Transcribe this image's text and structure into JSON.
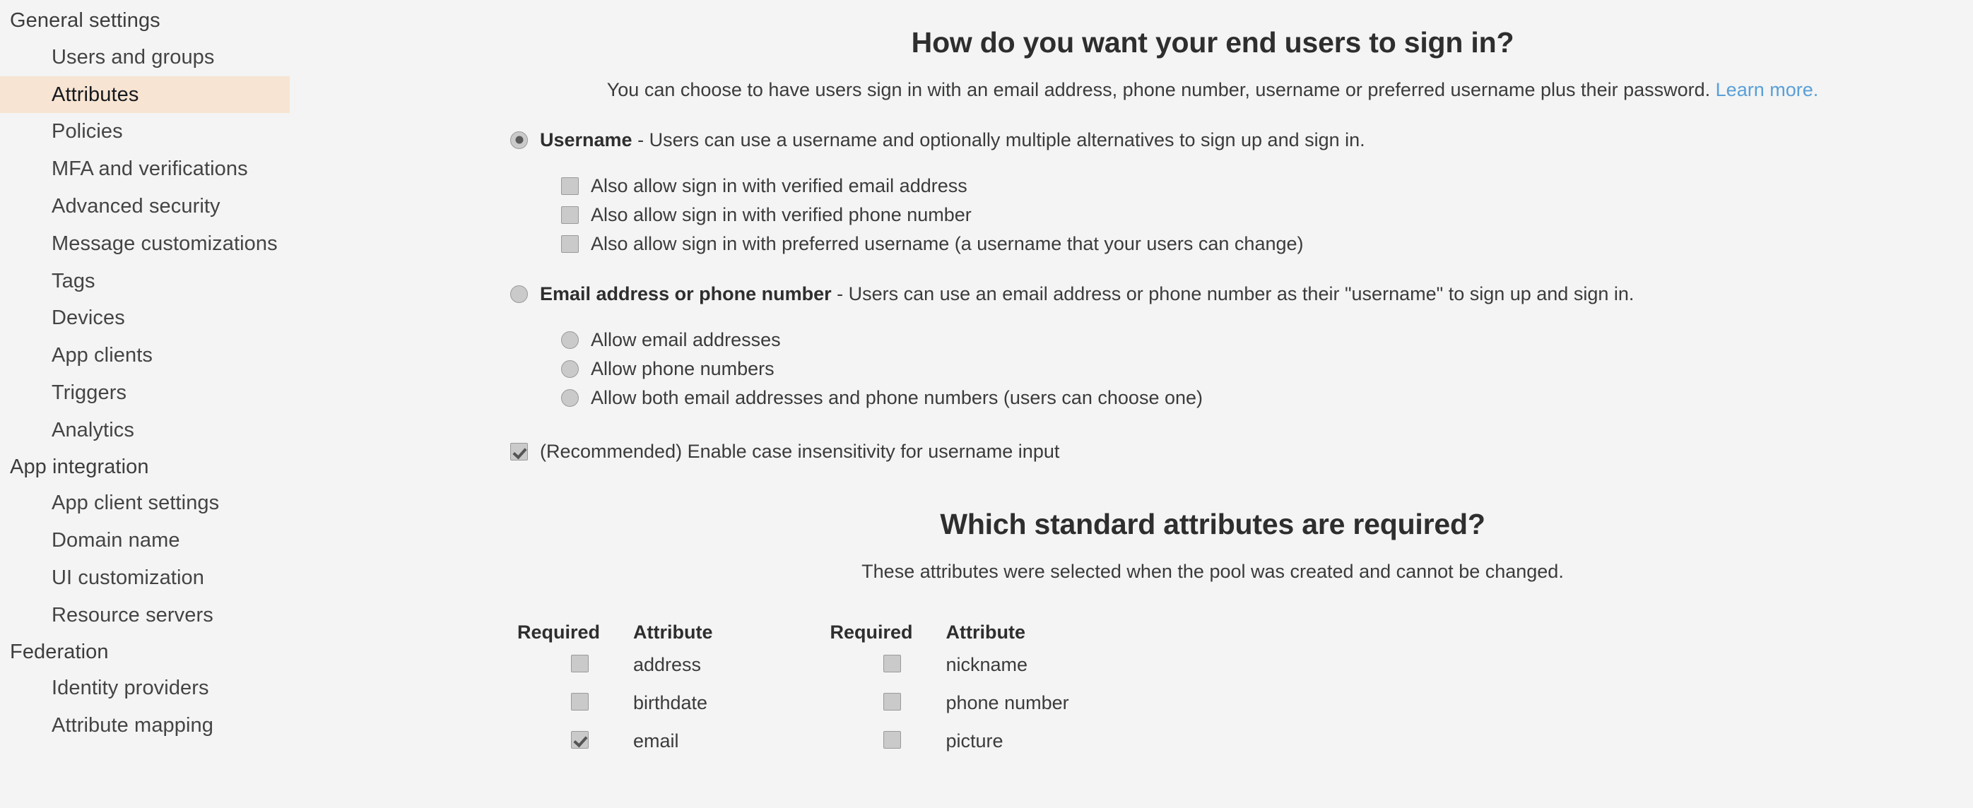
{
  "sidebar": {
    "groups": [
      {
        "title": "General settings",
        "items": [
          {
            "label": "Users and groups",
            "selected": false
          },
          {
            "label": "Attributes",
            "selected": true
          },
          {
            "label": "Policies",
            "selected": false
          },
          {
            "label": "MFA and verifications",
            "selected": false
          },
          {
            "label": "Advanced security",
            "selected": false
          },
          {
            "label": "Message customizations",
            "selected": false
          },
          {
            "label": "Tags",
            "selected": false
          },
          {
            "label": "Devices",
            "selected": false
          },
          {
            "label": "App clients",
            "selected": false
          },
          {
            "label": "Triggers",
            "selected": false
          },
          {
            "label": "Analytics",
            "selected": false
          }
        ]
      },
      {
        "title": "App integration",
        "items": [
          {
            "label": "App client settings",
            "selected": false
          },
          {
            "label": "Domain name",
            "selected": false
          },
          {
            "label": "UI customization",
            "selected": false
          },
          {
            "label": "Resource servers",
            "selected": false
          }
        ]
      },
      {
        "title": "Federation",
        "items": [
          {
            "label": "Identity providers",
            "selected": false
          },
          {
            "label": "Attribute mapping",
            "selected": false
          }
        ]
      }
    ]
  },
  "signin": {
    "heading": "How do you want your end users to sign in?",
    "description_prefix": "You can choose to have users sign in with an email address, phone number, username or preferred username plus their password.",
    "learn_more_label": "Learn more.",
    "username_option": {
      "label_bold": "Username",
      "label_rest": " - Users can use a username and optionally multiple alternatives to sign up and sign in.",
      "selected": true,
      "sub_options": [
        {
          "label": "Also allow sign in with verified email address",
          "checked": false
        },
        {
          "label": "Also allow sign in with verified phone number",
          "checked": false
        },
        {
          "label": "Also allow sign in with preferred username (a username that your users can change)",
          "checked": false
        }
      ]
    },
    "email_phone_option": {
      "label_bold": "Email address or phone number",
      "label_rest": " - Users can use an email address or phone number as their \"username\" to sign up and sign in.",
      "selected": false,
      "sub_options": [
        {
          "label": "Allow email addresses",
          "checked": false
        },
        {
          "label": "Allow phone numbers",
          "checked": false
        },
        {
          "label": "Allow both email addresses and phone numbers (users can choose one)",
          "checked": false
        }
      ]
    },
    "case_insensitivity": {
      "label": "(Recommended) Enable case insensitivity for username input",
      "checked": true
    }
  },
  "attributes": {
    "heading": "Which standard attributes are required?",
    "description": "These attributes were selected when the pool was created and cannot be changed.",
    "columns": [
      {
        "header_required": "Required",
        "header_attribute": "Attribute",
        "rows": [
          {
            "name": "address",
            "required": false
          },
          {
            "name": "birthdate",
            "required": false
          },
          {
            "name": "email",
            "required": true
          }
        ]
      },
      {
        "header_required": "Required",
        "header_attribute": "Attribute",
        "rows": [
          {
            "name": "nickname",
            "required": false
          },
          {
            "name": "phone number",
            "required": false
          },
          {
            "name": "picture",
            "required": false
          }
        ]
      }
    ]
  },
  "colors": {
    "page_background": "#f3f4f3",
    "selected_nav_background": "#f7e4d2",
    "link": "#5a9fd8",
    "text": "#3b3b3b",
    "heading": "#2e2e2e",
    "control_fill": "#cacaca",
    "control_border": "#9a9a9a"
  }
}
